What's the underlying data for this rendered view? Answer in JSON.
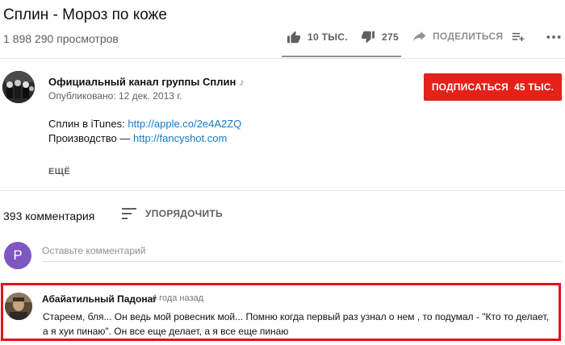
{
  "video": {
    "title": "Сплин - Мороз по коже",
    "views": "1 898 290 просмотров"
  },
  "actions": {
    "like_count": "10 ТЫС.",
    "dislike_count": "275",
    "share_label": "ПОДЕЛИТЬСЯ"
  },
  "channel": {
    "name": "Официальный канал группы Сплин",
    "note_glyph": "♪",
    "published": "Опубликовано: 12 дек. 2013 г.",
    "subscribe_label": "ПОДПИСАТЬСЯ",
    "subscriber_count": "45 ТЫС."
  },
  "description": {
    "line1_prefix": "Сплин в iTunes: ",
    "line1_link": "http://apple.co/2e4A2ZQ",
    "line2_prefix": "Производство — ",
    "line2_link": "http://fancyshot.com",
    "show_more": "ЕЩЁ"
  },
  "comments": {
    "count_label": "393 комментария",
    "sort_label": "УПОРЯДОЧИТЬ",
    "input_placeholder": "Оставьте комментарий",
    "user_initial": "P",
    "user_avatar_color": "#7e57c2",
    "items": [
      {
        "author": "Абайатильный Падонаг",
        "time": "4 года назад",
        "text": " Стареем, бля... Он ведь мой ровесник мой... Помню когда первый раз узнал о нем , то подумал - \"Кто то делает, а я хуи пинаю\". Он все еще делает, а я все еще пинаю"
      }
    ]
  },
  "colors": {
    "subscribe_red": "#e62117",
    "link_blue": "#167ac6",
    "highlight_red": "#e0121a"
  }
}
